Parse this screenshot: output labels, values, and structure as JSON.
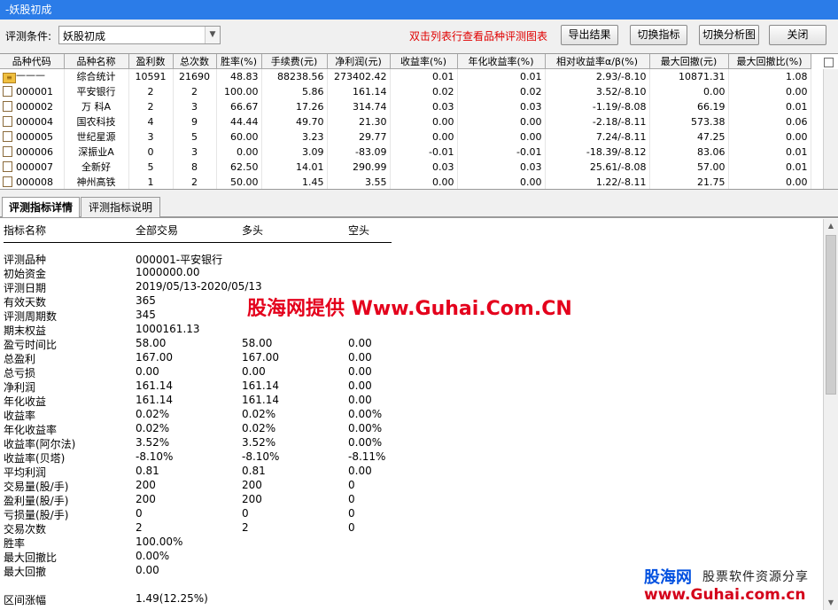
{
  "window": {
    "title": "-妖股初成"
  },
  "toolbar": {
    "condition_label": "评测条件:",
    "condition_value": "妖股初成",
    "hint": "双击列表行查看品种评测图表",
    "buttons": [
      {
        "label": "导出结果"
      },
      {
        "label": "切换指标"
      },
      {
        "label": "切换分析图"
      },
      {
        "label": "关闭"
      }
    ]
  },
  "grid": {
    "columns": [
      "品种代码",
      "品种名称",
      "盈利数",
      "总次数",
      "胜率(%)",
      "手续费(元)",
      "净利润(元)",
      "收益率(%)",
      "年化收益率(%)",
      "相对收益率α/β(%)",
      "最大回撤(元)",
      "最大回撤比(%)"
    ],
    "summary": {
      "code": "———",
      "name": "综合统计",
      "values": [
        "10591",
        "21690",
        "48.83",
        "88238.56",
        "273402.42",
        "0.01",
        "0.01",
        "2.93/-8.10",
        "10871.31",
        "1.08"
      ]
    },
    "rows": [
      {
        "code": "000001",
        "name": "平安银行",
        "values": [
          "2",
          "2",
          "100.00",
          "5.86",
          "161.14",
          "0.02",
          "0.02",
          "3.52/-8.10",
          "0.00",
          "0.00"
        ]
      },
      {
        "code": "000002",
        "name": "万 科A",
        "values": [
          "2",
          "3",
          "66.67",
          "17.26",
          "314.74",
          "0.03",
          "0.03",
          "-1.19/-8.08",
          "66.19",
          "0.01"
        ]
      },
      {
        "code": "000004",
        "name": "国农科技",
        "values": [
          "4",
          "9",
          "44.44",
          "49.70",
          "21.30",
          "0.00",
          "0.00",
          "-2.18/-8.11",
          "573.38",
          "0.06"
        ]
      },
      {
        "code": "000005",
        "name": "世纪星源",
        "values": [
          "3",
          "5",
          "60.00",
          "3.23",
          "29.77",
          "0.00",
          "0.00",
          "7.24/-8.11",
          "47.25",
          "0.00"
        ]
      },
      {
        "code": "000006",
        "name": "深振业A",
        "values": [
          "0",
          "3",
          "0.00",
          "3.09",
          "-83.09",
          "-0.01",
          "-0.01",
          "-18.39/-8.12",
          "83.06",
          "0.01"
        ]
      },
      {
        "code": "000007",
        "name": "全新好",
        "values": [
          "5",
          "8",
          "62.50",
          "14.01",
          "290.99",
          "0.03",
          "0.03",
          "25.61/-8.08",
          "57.00",
          "0.01"
        ]
      },
      {
        "code": "000008",
        "name": "神州高铁",
        "values": [
          "1",
          "2",
          "50.00",
          "1.45",
          "3.55",
          "0.00",
          "0.00",
          "1.22/-8.11",
          "21.75",
          "0.00"
        ]
      }
    ]
  },
  "tabs": [
    {
      "label": "评测指标详情"
    },
    {
      "label": "评测指标说明"
    }
  ],
  "detail": {
    "headers": [
      "指标名称",
      "全部交易",
      "多头",
      "空头"
    ],
    "rows": [
      {
        "name": "评测品种",
        "all": "000001-平安银行",
        "long": "",
        "short": ""
      },
      {
        "name": "初始资金",
        "all": "1000000.00",
        "long": "",
        "short": ""
      },
      {
        "name": "评测日期",
        "all": "2019/05/13-2020/05/13",
        "long": "",
        "short": ""
      },
      {
        "name": "有效天数",
        "all": "365",
        "long": "",
        "short": ""
      },
      {
        "name": "评测周期数",
        "all": "345",
        "long": "",
        "short": ""
      },
      {
        "name": "期末权益",
        "all": "1000161.13",
        "long": "",
        "short": ""
      },
      {
        "name": "盈亏时间比",
        "all": "58.00",
        "long": "58.00",
        "short": "0.00"
      },
      {
        "name": "总盈利",
        "all": "167.00",
        "long": "167.00",
        "short": "0.00"
      },
      {
        "name": "总亏损",
        "all": "0.00",
        "long": "0.00",
        "short": "0.00"
      },
      {
        "name": "净利润",
        "all": "161.14",
        "long": "161.14",
        "short": "0.00"
      },
      {
        "name": "年化收益",
        "all": "161.14",
        "long": "161.14",
        "short": "0.00"
      },
      {
        "name": "收益率",
        "all": "0.02%",
        "long": "0.02%",
        "short": "0.00%"
      },
      {
        "name": "年化收益率",
        "all": "0.02%",
        "long": "0.02%",
        "short": "0.00%"
      },
      {
        "name": "收益率(阿尔法)",
        "all": "3.52%",
        "long": "3.52%",
        "short": "0.00%"
      },
      {
        "name": "收益率(贝塔)",
        "all": "-8.10%",
        "long": "-8.10%",
        "short": "-8.11%"
      },
      {
        "name": "平均利润",
        "all": "0.81",
        "long": "0.81",
        "short": "0.00"
      },
      {
        "name": "交易量(股/手)",
        "all": "200",
        "long": "200",
        "short": "0"
      },
      {
        "name": "盈利量(股/手)",
        "all": "200",
        "long": "200",
        "short": "0"
      },
      {
        "name": "亏损量(股/手)",
        "all": "0",
        "long": "0",
        "short": "0"
      },
      {
        "name": "交易次数",
        "all": "2",
        "long": "2",
        "short": "0"
      },
      {
        "name": "胜率",
        "all": "100.00%",
        "long": "",
        "short": ""
      },
      {
        "name": "最大回撤比",
        "all": "0.00%",
        "long": "",
        "short": ""
      },
      {
        "name": "最大回撤",
        "all": "0.00",
        "long": "",
        "short": ""
      },
      {
        "name": "",
        "all": "",
        "long": "",
        "short": ""
      },
      {
        "name": "区间涨幅",
        "all": "1.49(12.25%)",
        "long": "",
        "short": ""
      }
    ]
  },
  "watermark": {
    "center": "股海网提供 Www.Guhai.Com.CN",
    "logo_brand": "股海网",
    "logo_slogan": "股票软件资源分享",
    "logo_url": "www.Guhai.com.cn"
  },
  "icons": {
    "summary_row": "summary-icon",
    "stock_row": "document-icon",
    "combo": "chevron-down-icon"
  }
}
